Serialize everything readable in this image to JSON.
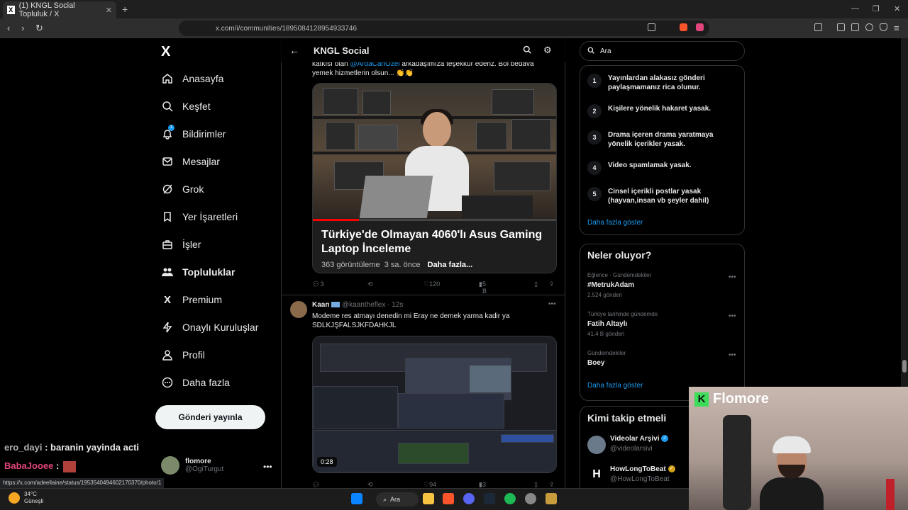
{
  "browser": {
    "tab_title": "(1) KNGL Social Topluluk / X",
    "url": "x.com/i/communities/1895084128954933746",
    "status_url": "https://x.com/adeellaine/status/1953540494602170370/photo/1"
  },
  "sidebar": {
    "logo": "X",
    "items": [
      {
        "label": "Anasayfa",
        "icon": "home-icon"
      },
      {
        "label": "Keşfet",
        "icon": "search-icon"
      },
      {
        "label": "Bildirimler",
        "icon": "bell-icon",
        "badge": "1"
      },
      {
        "label": "Mesajlar",
        "icon": "mail-icon"
      },
      {
        "label": "Grok",
        "icon": "grok-icon"
      },
      {
        "label": "Yer İşaretleri",
        "icon": "bookmark-icon"
      },
      {
        "label": "İşler",
        "icon": "briefcase-icon"
      },
      {
        "label": "Topluluklar",
        "icon": "communities-icon",
        "active": true
      },
      {
        "label": "Premium",
        "icon": "x-icon"
      },
      {
        "label": "Onaylı Kuruluşlar",
        "icon": "lightning-icon"
      },
      {
        "label": "Profil",
        "icon": "person-icon"
      },
      {
        "label": "Daha fazla",
        "icon": "more-circle-icon"
      }
    ],
    "post_button": "Gönderi yayınla",
    "profile": {
      "name": "flomore",
      "handle": "@OgiTurgut"
    }
  },
  "chat": [
    {
      "user": "ero_dayi",
      "message": " : baranin yayinda acti"
    },
    {
      "user": "BabaJooee",
      "message": " : "
    }
  ],
  "header": {
    "title": "KNGL Social"
  },
  "post1": {
    "text_line1_pre": "katkısı olan ",
    "mention": "@ArdaCanOzel",
    "text_line1_post": " arkadaşımıza teşekkür ederiz. Bol bedava",
    "text_line2": "yemek hizmetlerin olsun... 👏👏",
    "card_title": "Türkiye'de Olmayan 4060'lı Asus Gaming Laptop İnceleme",
    "card_views": "363 görüntüleme",
    "card_time": "3 sa. önce",
    "card_more": "Daha fazla...",
    "replies": "3",
    "retweets": "",
    "likes": "120",
    "views": "5 B"
  },
  "post2": {
    "name": "Kaan",
    "handle": "@kaantheflex",
    "time": "12s",
    "text_line1": "Modeme res atmayı denedin mi Eray ne demek  yarma kadir ya",
    "text_line2": "SDLKJŞFALSJKFDAHKJL",
    "video_duration": "0:28",
    "likes": "94",
    "views": "3 B"
  },
  "search": {
    "placeholder": "Ara"
  },
  "rules": [
    {
      "num": "1",
      "text": "Yayınlardan alakasız gönderi paylaşmamanız rica olunur."
    },
    {
      "num": "2",
      "text": "Kişilere yönelik hakaret yasak."
    },
    {
      "num": "3",
      "text": "Drama içeren drama yaratmaya yönelik içerikler yasak."
    },
    {
      "num": "4",
      "text": "Video spamlamak yasak."
    },
    {
      "num": "5",
      "text": "Cinsel içerikli postlar yasak (hayvan,insan vb şeyler dahil)"
    }
  ],
  "rules_more": "Daha fazla göster",
  "trends": {
    "title": "Neler oluyor?",
    "items": [
      {
        "category": "Eğlence · Gündemdekiler",
        "name": "#MetrukAdam",
        "count": "2.524 gönderi"
      },
      {
        "category": "Türkiye tarihinde gündemde",
        "name": "Fatih Altaylı",
        "count": "41,4 B gönderi"
      },
      {
        "category": "Gündemdekiler",
        "name": "Boey",
        "count": ""
      }
    ],
    "more": "Daha fazla göster"
  },
  "follow": {
    "title": "Kimi takip etmeli",
    "items": [
      {
        "name": "Videolar Arşivi",
        "handle": "@videolarsivi"
      },
      {
        "name": "HowLongToBeat",
        "handle": "@HowLongToBeat"
      }
    ]
  },
  "webcam": {
    "brand": "Flomore"
  },
  "taskbar": {
    "temp": "34°C",
    "weather": "Güneşli",
    "search": "Ara"
  }
}
